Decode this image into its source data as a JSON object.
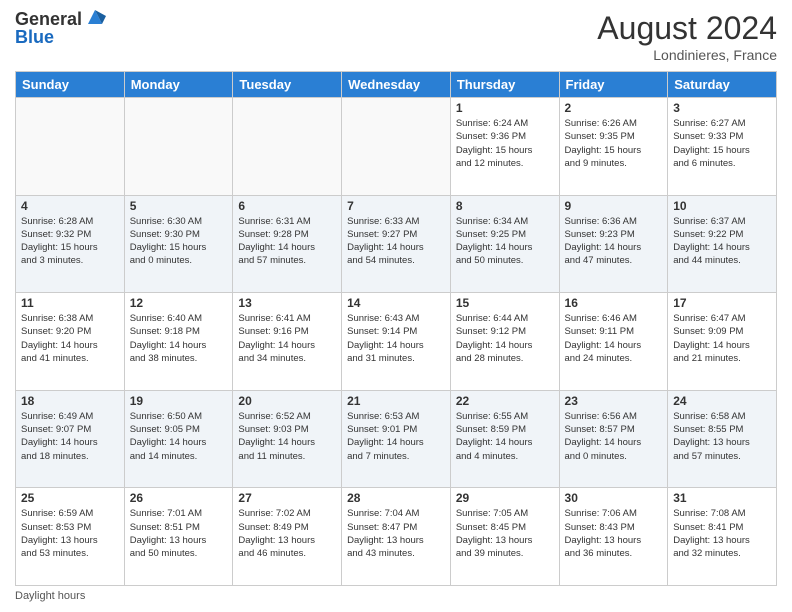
{
  "header": {
    "logo_general": "General",
    "logo_blue": "Blue",
    "month_title": "August 2024",
    "location": "Londinieres, France"
  },
  "footer": {
    "note": "Daylight hours"
  },
  "days_of_week": [
    "Sunday",
    "Monday",
    "Tuesday",
    "Wednesday",
    "Thursday",
    "Friday",
    "Saturday"
  ],
  "weeks": [
    [
      {
        "day": "",
        "info": ""
      },
      {
        "day": "",
        "info": ""
      },
      {
        "day": "",
        "info": ""
      },
      {
        "day": "",
        "info": ""
      },
      {
        "day": "1",
        "info": "Sunrise: 6:24 AM\nSunset: 9:36 PM\nDaylight: 15 hours\nand 12 minutes."
      },
      {
        "day": "2",
        "info": "Sunrise: 6:26 AM\nSunset: 9:35 PM\nDaylight: 15 hours\nand 9 minutes."
      },
      {
        "day": "3",
        "info": "Sunrise: 6:27 AM\nSunset: 9:33 PM\nDaylight: 15 hours\nand 6 minutes."
      }
    ],
    [
      {
        "day": "4",
        "info": "Sunrise: 6:28 AM\nSunset: 9:32 PM\nDaylight: 15 hours\nand 3 minutes."
      },
      {
        "day": "5",
        "info": "Sunrise: 6:30 AM\nSunset: 9:30 PM\nDaylight: 15 hours\nand 0 minutes."
      },
      {
        "day": "6",
        "info": "Sunrise: 6:31 AM\nSunset: 9:28 PM\nDaylight: 14 hours\nand 57 minutes."
      },
      {
        "day": "7",
        "info": "Sunrise: 6:33 AM\nSunset: 9:27 PM\nDaylight: 14 hours\nand 54 minutes."
      },
      {
        "day": "8",
        "info": "Sunrise: 6:34 AM\nSunset: 9:25 PM\nDaylight: 14 hours\nand 50 minutes."
      },
      {
        "day": "9",
        "info": "Sunrise: 6:36 AM\nSunset: 9:23 PM\nDaylight: 14 hours\nand 47 minutes."
      },
      {
        "day": "10",
        "info": "Sunrise: 6:37 AM\nSunset: 9:22 PM\nDaylight: 14 hours\nand 44 minutes."
      }
    ],
    [
      {
        "day": "11",
        "info": "Sunrise: 6:38 AM\nSunset: 9:20 PM\nDaylight: 14 hours\nand 41 minutes."
      },
      {
        "day": "12",
        "info": "Sunrise: 6:40 AM\nSunset: 9:18 PM\nDaylight: 14 hours\nand 38 minutes."
      },
      {
        "day": "13",
        "info": "Sunrise: 6:41 AM\nSunset: 9:16 PM\nDaylight: 14 hours\nand 34 minutes."
      },
      {
        "day": "14",
        "info": "Sunrise: 6:43 AM\nSunset: 9:14 PM\nDaylight: 14 hours\nand 31 minutes."
      },
      {
        "day": "15",
        "info": "Sunrise: 6:44 AM\nSunset: 9:12 PM\nDaylight: 14 hours\nand 28 minutes."
      },
      {
        "day": "16",
        "info": "Sunrise: 6:46 AM\nSunset: 9:11 PM\nDaylight: 14 hours\nand 24 minutes."
      },
      {
        "day": "17",
        "info": "Sunrise: 6:47 AM\nSunset: 9:09 PM\nDaylight: 14 hours\nand 21 minutes."
      }
    ],
    [
      {
        "day": "18",
        "info": "Sunrise: 6:49 AM\nSunset: 9:07 PM\nDaylight: 14 hours\nand 18 minutes."
      },
      {
        "day": "19",
        "info": "Sunrise: 6:50 AM\nSunset: 9:05 PM\nDaylight: 14 hours\nand 14 minutes."
      },
      {
        "day": "20",
        "info": "Sunrise: 6:52 AM\nSunset: 9:03 PM\nDaylight: 14 hours\nand 11 minutes."
      },
      {
        "day": "21",
        "info": "Sunrise: 6:53 AM\nSunset: 9:01 PM\nDaylight: 14 hours\nand 7 minutes."
      },
      {
        "day": "22",
        "info": "Sunrise: 6:55 AM\nSunset: 8:59 PM\nDaylight: 14 hours\nand 4 minutes."
      },
      {
        "day": "23",
        "info": "Sunrise: 6:56 AM\nSunset: 8:57 PM\nDaylight: 14 hours\nand 0 minutes."
      },
      {
        "day": "24",
        "info": "Sunrise: 6:58 AM\nSunset: 8:55 PM\nDaylight: 13 hours\nand 57 minutes."
      }
    ],
    [
      {
        "day": "25",
        "info": "Sunrise: 6:59 AM\nSunset: 8:53 PM\nDaylight: 13 hours\nand 53 minutes."
      },
      {
        "day": "26",
        "info": "Sunrise: 7:01 AM\nSunset: 8:51 PM\nDaylight: 13 hours\nand 50 minutes."
      },
      {
        "day": "27",
        "info": "Sunrise: 7:02 AM\nSunset: 8:49 PM\nDaylight: 13 hours\nand 46 minutes."
      },
      {
        "day": "28",
        "info": "Sunrise: 7:04 AM\nSunset: 8:47 PM\nDaylight: 13 hours\nand 43 minutes."
      },
      {
        "day": "29",
        "info": "Sunrise: 7:05 AM\nSunset: 8:45 PM\nDaylight: 13 hours\nand 39 minutes."
      },
      {
        "day": "30",
        "info": "Sunrise: 7:06 AM\nSunset: 8:43 PM\nDaylight: 13 hours\nand 36 minutes."
      },
      {
        "day": "31",
        "info": "Sunrise: 7:08 AM\nSunset: 8:41 PM\nDaylight: 13 hours\nand 32 minutes."
      }
    ]
  ]
}
